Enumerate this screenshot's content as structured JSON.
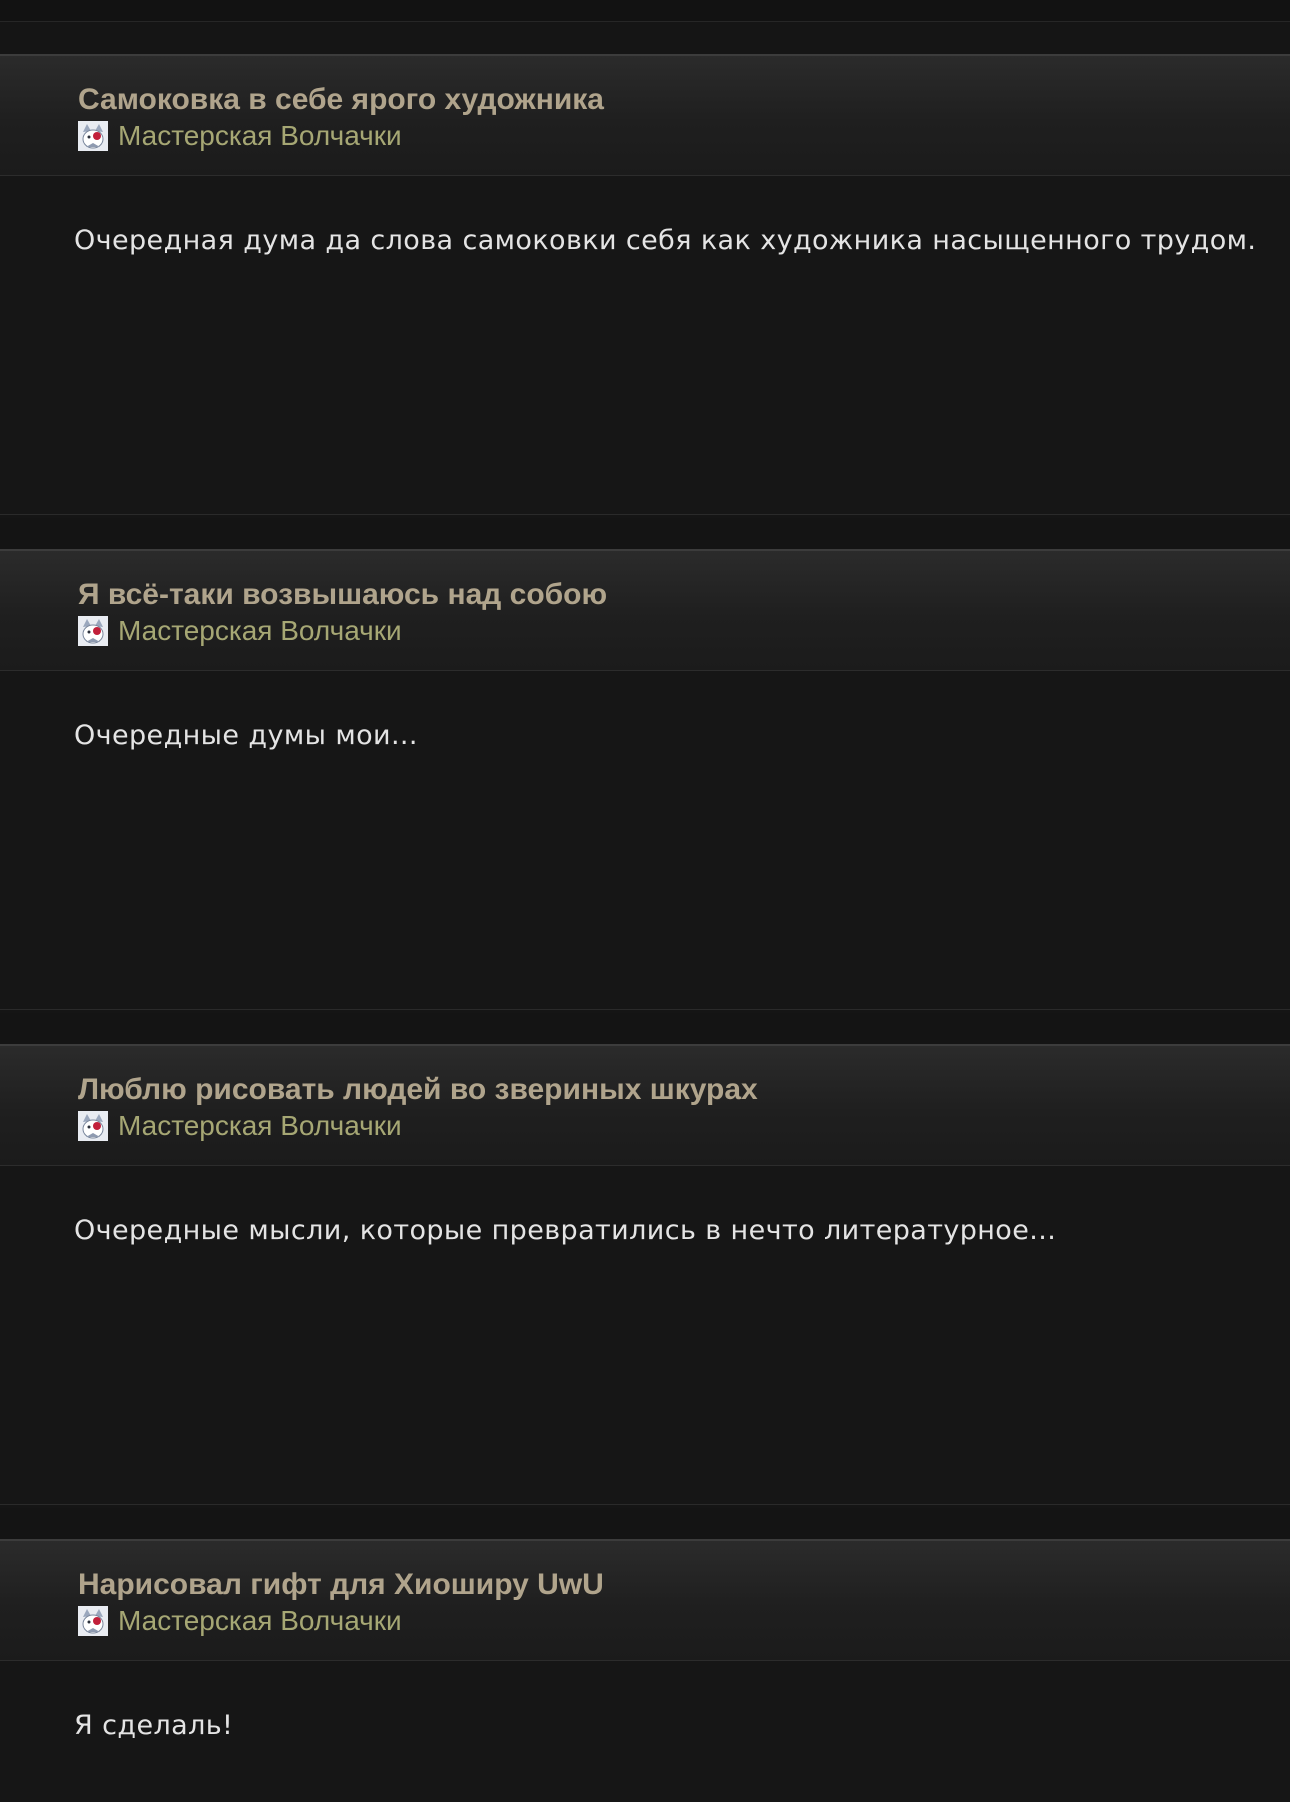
{
  "posts": [
    {
      "title": "Самоковка в себе ярого художника",
      "author": "Мастерская Волчачки",
      "excerpt": "Очередная дума да слова самоковки себя как художника насыщенного трудом."
    },
    {
      "title": "Я всё-таки возвышаюсь над собою",
      "author": "Мастерская Волчачки",
      "excerpt": "Очередные думы мои..."
    },
    {
      "title": "Люблю рисовать людей во звериных шкурах",
      "author": "Мастерская Волчачки",
      "excerpt": "Очередные мысли, которые превратились в нечто литературное..."
    },
    {
      "title": "Нарисовал гифт для Хиоширу UwU",
      "author": "Мастерская Волчачки",
      "excerpt": "Я сделаль!"
    }
  ],
  "colors": {
    "background": "#151515",
    "title": "#b0a48c",
    "author": "#a6a774",
    "excerpt": "#e4e4e4"
  },
  "icons": {
    "author_avatar": "wolf-avatar-icon"
  }
}
